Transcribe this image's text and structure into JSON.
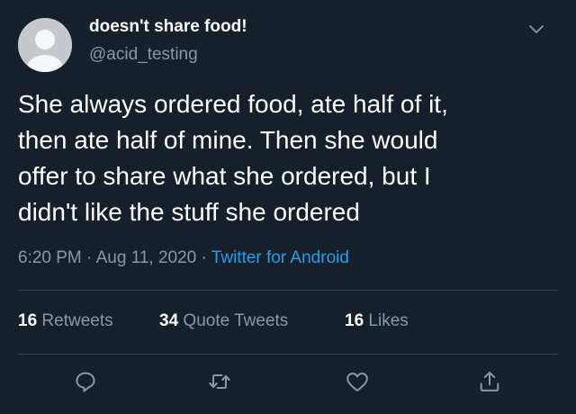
{
  "tweet": {
    "display_name": "doesn't share food!",
    "handle": "@acid_testing",
    "text": "She always ordered food, ate half of it,\nthen ate half of mine. Then she would\noffer to share what she ordered, but I\ndidn't like the stuff she ordered",
    "time": "6:20 PM",
    "separator": "·",
    "date": "Aug 11, 2020",
    "source": "Twitter for Android"
  },
  "stats": {
    "retweets": {
      "count": "16",
      "label": "Retweets"
    },
    "quote_tweets": {
      "count": "34",
      "label": "Quote Tweets"
    },
    "likes": {
      "count": "16",
      "label": "Likes"
    }
  },
  "icons": {
    "avatar": "default-avatar-icon",
    "menu": "chevron-down-icon",
    "reply": "reply-icon",
    "retweet": "retweet-icon",
    "like": "heart-icon",
    "share": "share-icon"
  },
  "colors": {
    "background": "#15202b",
    "text_primary": "#ffffff",
    "text_secondary": "#8899a6",
    "accent": "#1da1f2",
    "divider": "#38444d"
  }
}
